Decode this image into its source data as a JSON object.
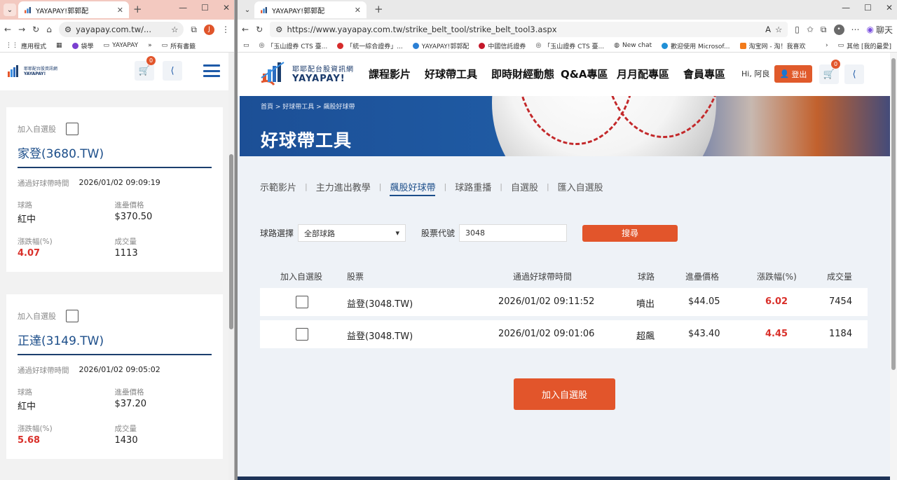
{
  "left_window": {
    "tab_title": "YAYAPAY!郭郭配",
    "url": "yayapay.com.tw/...",
    "bookmarks": [
      "應用程式",
      "袋學",
      "YAYAPAY",
      "所有書籤"
    ],
    "cart_count": "0",
    "logo_line1": "耶耶配台股資訊網",
    "logo_line2": "YAYAPAY!",
    "cards": [
      {
        "add_label": "加入自選股",
        "name": "家登(3680.TW)",
        "time_label": "通過好球帶時間",
        "time": "2026/01/02 09:09:19",
        "pitch_label": "球路",
        "pitch": "紅中",
        "price_label": "進壘價格",
        "price": "$370.50",
        "change_label": "漲跌幅(%)",
        "change": "4.07",
        "volume_label": "成交量",
        "volume": "1113"
      },
      {
        "add_label": "加入自選股",
        "name": "正達(3149.TW)",
        "time_label": "通過好球帶時間",
        "time": "2026/01/02 09:05:02",
        "pitch_label": "球路",
        "pitch": "紅中",
        "price_label": "進壘價格",
        "price": "$37.20",
        "change_label": "漲跌幅(%)",
        "change": "5.68",
        "volume_label": "成交量",
        "volume": "1430"
      }
    ]
  },
  "right_window": {
    "tab_title": "YAYAPAY!郭郭配",
    "url": "https://www.yayapay.com.tw/strike_belt_tool/strike_belt_tool3.aspx",
    "chat_label": "聊天",
    "bookmarks": [
      "「玉山證券 CTS 臺...",
      "「統一綜合證券」...",
      "YAYAPAY!郭郭配",
      "中國信託證券",
      "「玉山證券 CTS 臺...",
      "New chat",
      "歡迎使用 Microsof...",
      "淘宝网 - 淘！我喜欢",
      "其他 [我的最愛]"
    ],
    "logo_line1": "耶耶配台股資訊網",
    "logo_line2": "YAYAPAY!",
    "nav": [
      "課程影片",
      "好球帶工具",
      "即時財經動態",
      "Q&A專區",
      "月月配專區",
      "會員專區"
    ],
    "greeting": "Hi, 阿良",
    "login_label": "登出",
    "cart_count": "0",
    "breadcrumb": "首頁  >  好球帶工具  >  飆股好球帶",
    "banner_title": "好球帶工具",
    "subnav": [
      "示範影片",
      "主力進出教學",
      "飆股好球帶",
      "球路重播",
      "自選股",
      "匯入自選股"
    ],
    "subnav_active": "飆股好球帶",
    "filter": {
      "pitch_label": "球路選擇",
      "pitch_value": "全部球路",
      "code_label": "股票代號",
      "code_value": "3048",
      "search_label": "搜尋"
    },
    "table": {
      "headers": [
        "加入自選股",
        "股票",
        "通過好球帶時間",
        "球路",
        "進壘價格",
        "漲跌幅(%)",
        "成交量"
      ],
      "rows": [
        {
          "stock": "益登(3048.TW)",
          "time": "2026/01/02 09:11:52",
          "pitch": "噴出",
          "price": "$44.05",
          "change": "6.02",
          "volume": "7454"
        },
        {
          "stock": "益登(3048.TW)",
          "time": "2026/01/02 09:01:06",
          "pitch": "超飆",
          "price": "$43.40",
          "change": "4.45",
          "volume": "1184"
        }
      ]
    },
    "add_button": "加入自選股"
  },
  "colors": {
    "accent": "#e2552b",
    "brand_blue": "#1c4e8a",
    "up_red": "#d9302a"
  }
}
